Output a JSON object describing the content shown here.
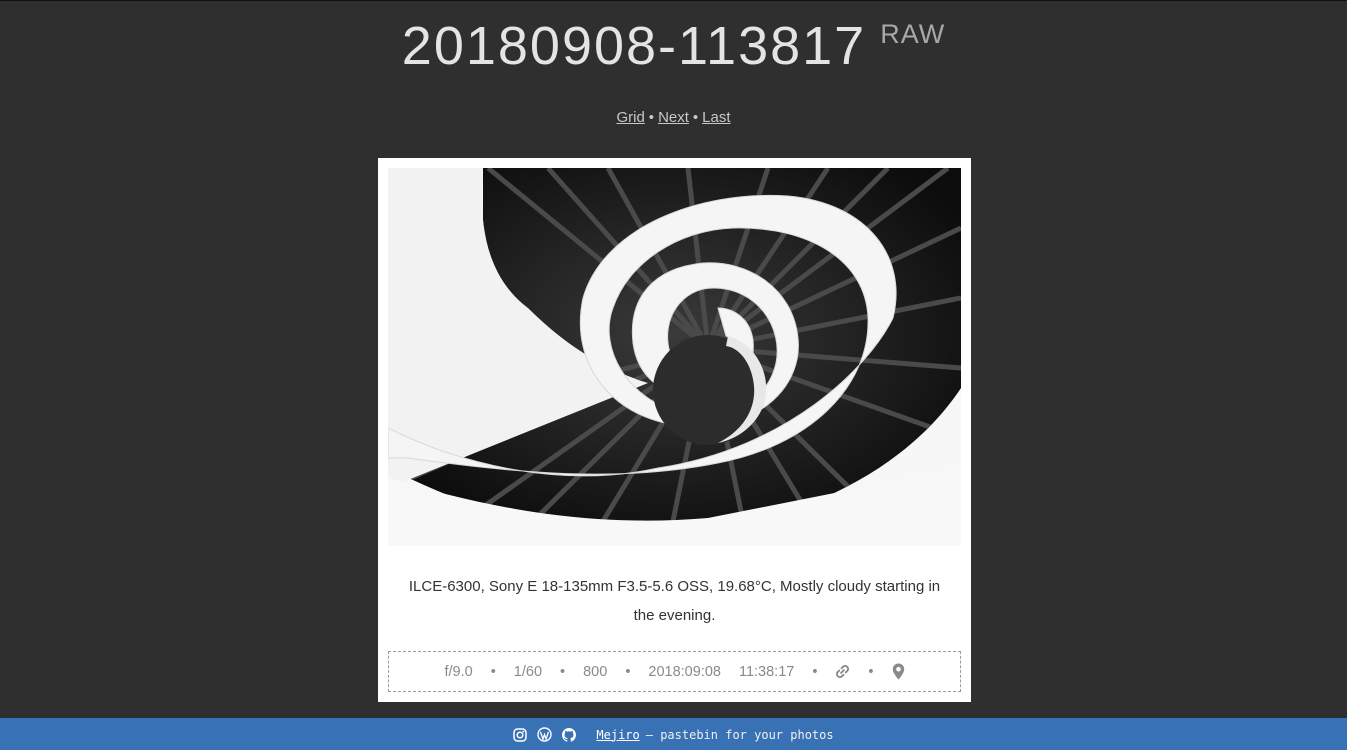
{
  "header": {
    "title": "20180908-113817",
    "raw_label": "RAW"
  },
  "nav": {
    "grid": "Grid",
    "next": "Next",
    "last": "Last",
    "separator": "•"
  },
  "photo": {
    "caption": "ILCE-6300, Sony E 18-135mm F3.5-5.6 OSS, 19.68°C, Mostly cloudy starting in the evening."
  },
  "exif": {
    "aperture": "f/9.0",
    "shutter": "1/60",
    "iso": "800",
    "date": "2018:09:08",
    "time": "11:38:17",
    "separator": "•",
    "link_icon": "link-icon",
    "location_icon": "map-pin-icon"
  },
  "footer": {
    "icons": [
      "instagram-icon",
      "wordpress-icon",
      "github-icon"
    ],
    "app_name": "Mejiro",
    "tagline": "— pastebin for your photos",
    "background": "#3872b5"
  }
}
